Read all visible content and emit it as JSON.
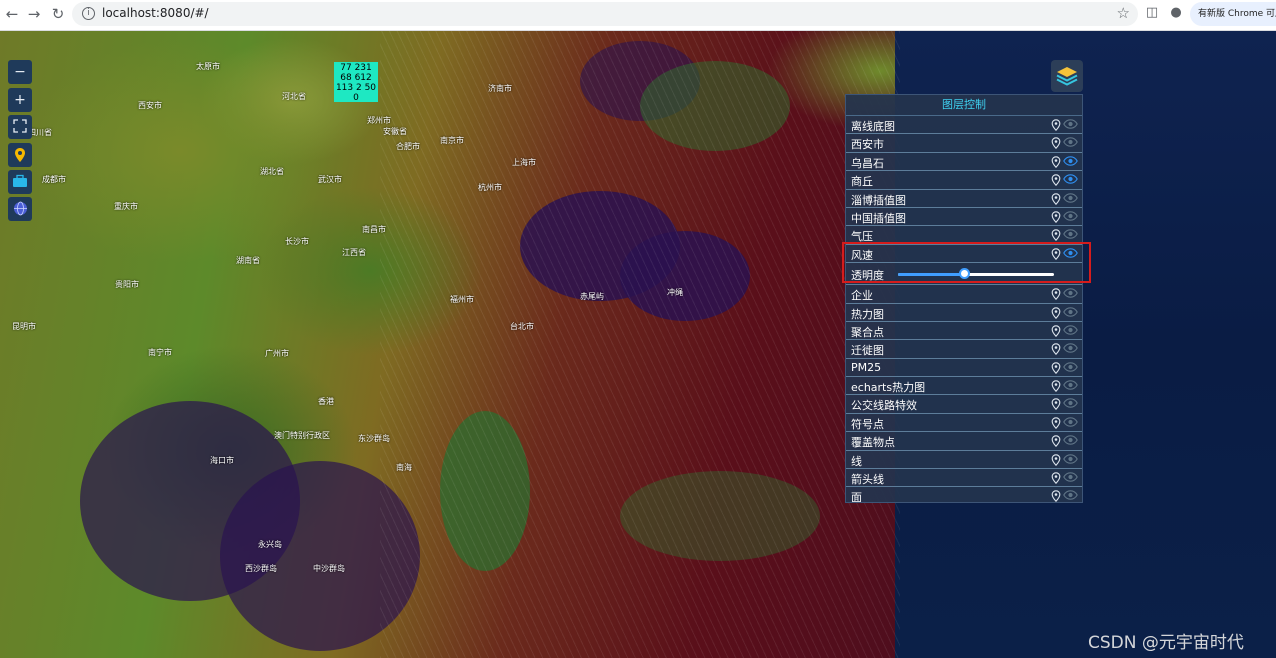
{
  "browser": {
    "url": "localhost:8080/#/",
    "update_label": "有新版 Chrome 可用"
  },
  "map": {
    "cluster_text": "77 231 68 612 113 2 50 0",
    "cities": [
      "西安市",
      "郑州市",
      "济南市",
      "河北省",
      "太原市",
      "合肥市",
      "南京市",
      "上海市",
      "杭州市",
      "武汉市",
      "成都市",
      "重庆市",
      "长沙市",
      "南昌市",
      "贵阳市",
      "福州市",
      "台北市",
      "广州市",
      "南宁市",
      "香港",
      "澳门特别行政区",
      "海口市",
      "东沙群岛",
      "西沙群岛",
      "永兴岛",
      "中沙群岛",
      "南海",
      "冲绳",
      "赤尾屿",
      "昆明市",
      "湖南省",
      "江西省",
      "安徽省",
      "湖北省",
      "四川省"
    ]
  },
  "panel": {
    "title": "图层控制",
    "layers": [
      {
        "label": "离线底图",
        "visible": false
      },
      {
        "label": "西安市",
        "visible": false
      },
      {
        "label": "乌昌石",
        "visible": true
      },
      {
        "label": "商丘",
        "visible": true
      },
      {
        "label": "淄博插值图",
        "visible": false
      },
      {
        "label": "中国插值图",
        "visible": false
      },
      {
        "label": "气压",
        "visible": false
      },
      {
        "label": "风速",
        "visible": true
      }
    ],
    "opacity_label": "透明度",
    "opacity_value": 0.43,
    "layers_after": [
      {
        "label": "企业",
        "visible": false
      },
      {
        "label": "热力图",
        "visible": false
      },
      {
        "label": "聚合点",
        "visible": false
      },
      {
        "label": "迁徙图",
        "visible": false
      },
      {
        "label": "PM25",
        "visible": false
      },
      {
        "label": "echarts热力图",
        "visible": false
      },
      {
        "label": "公交线路特效",
        "visible": false
      },
      {
        "label": "符号点",
        "visible": false
      },
      {
        "label": "覆盖物点",
        "visible": false
      },
      {
        "label": "线",
        "visible": false
      },
      {
        "label": "箭头线",
        "visible": false
      },
      {
        "label": "面",
        "visible": false
      }
    ]
  },
  "colors": {
    "accent": "#409eff",
    "title": "#3fd0ef",
    "eye_on": "#2f8ff0",
    "eye_off": "#5f7486",
    "highlight": "#d51c1c"
  },
  "watermark": "CSDN @元宇宙时代"
}
